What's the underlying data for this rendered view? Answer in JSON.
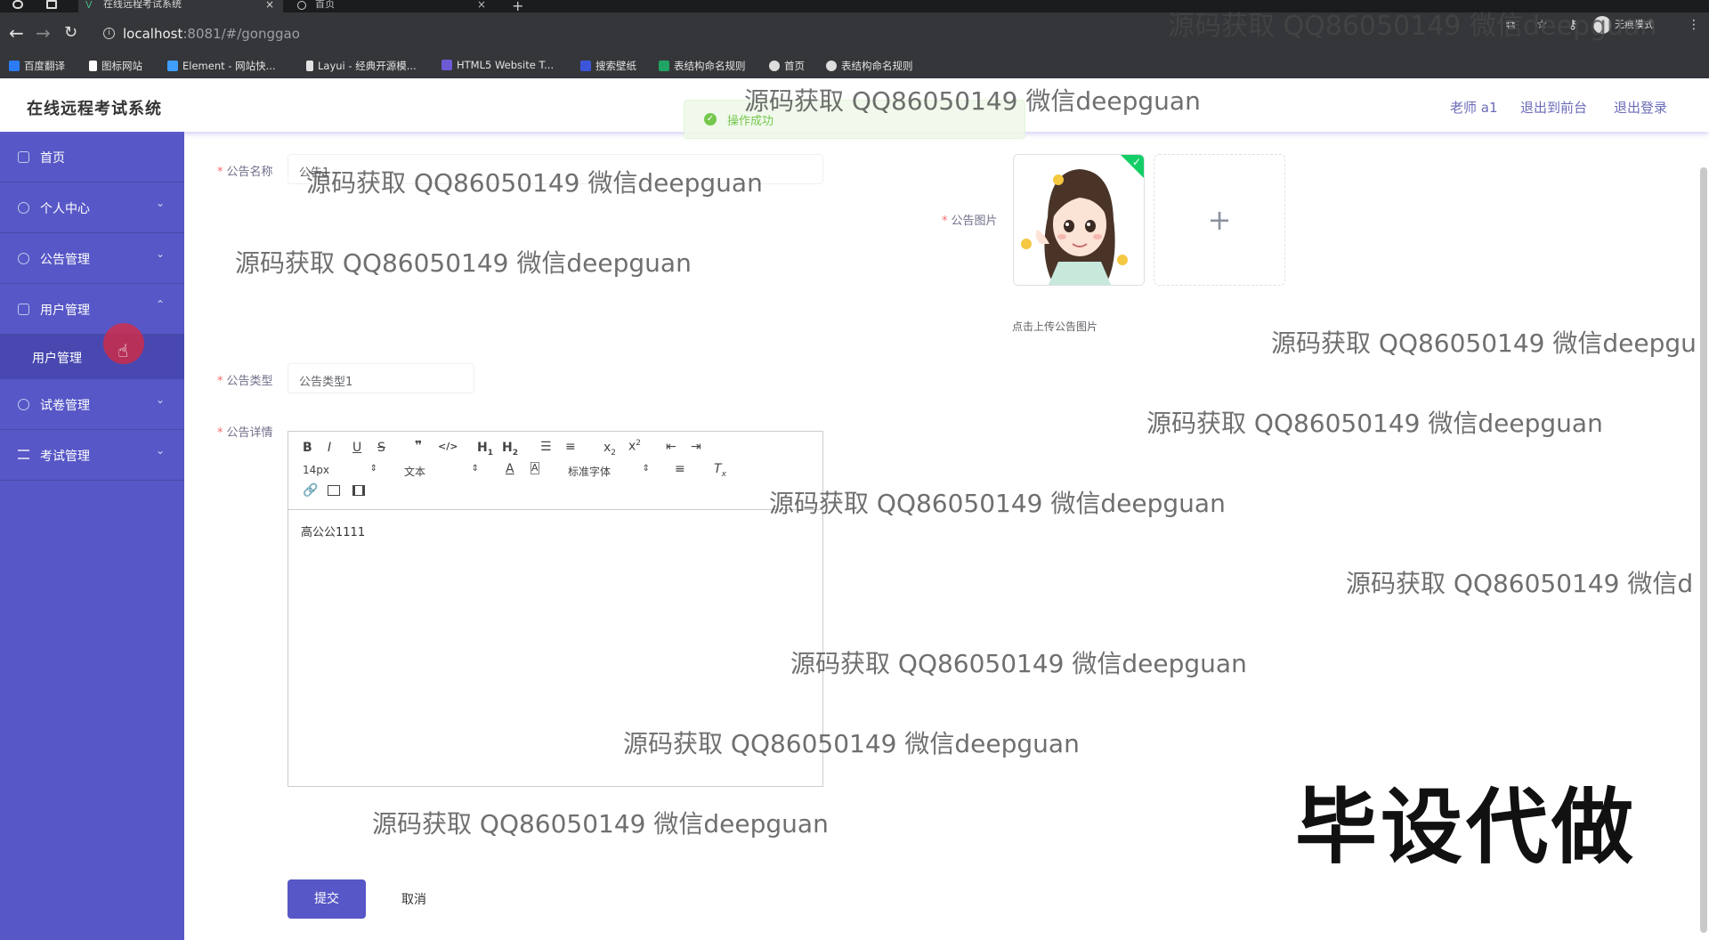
{
  "browser": {
    "tabs": [
      {
        "label": "在线远程考试系统",
        "close": "×"
      },
      {
        "label": "首页",
        "close": "×"
      }
    ],
    "new_tab": "+",
    "url_host": "localhost",
    "url_path": ":8081/#/gonggao",
    "incognito_label": "无痕模式",
    "bookmarks": [
      {
        "label": "百度翻译",
        "icon": "baidu-translate-icon",
        "color": "#2b7cf6"
      },
      {
        "label": "图标网站",
        "icon": "flag-icon",
        "color": "#ffffff"
      },
      {
        "label": "Element - 网站快...",
        "icon": "element-icon",
        "color": "#409eff"
      },
      {
        "label": "Layui - 经典开源模...",
        "icon": "layui-icon",
        "color": "#e2e2e2"
      },
      {
        "label": "HTML5 Website T...",
        "icon": "html5-icon",
        "color": "#6b5cd6"
      },
      {
        "label": "搜索壁纸",
        "icon": "wallpaper-icon",
        "color": "#3b55d9"
      },
      {
        "label": "表结构命名规则",
        "icon": "sheet-icon",
        "color": "#1fa463"
      },
      {
        "label": "首页",
        "icon": "globe-icon",
        "color": "#dddddd"
      },
      {
        "label": "表结构命名规则",
        "icon": "globe-icon",
        "color": "#dddddd"
      }
    ]
  },
  "header": {
    "title": "在线远程考试系统",
    "user": "老师 a1",
    "back_front": "退出到前台",
    "logout": "退出登录"
  },
  "sidebar": {
    "items": [
      {
        "label": "首页",
        "arrow": ""
      },
      {
        "label": "个人中心",
        "arrow": "⌄"
      },
      {
        "label": "公告管理",
        "arrow": "⌄"
      },
      {
        "label": "用户管理",
        "arrow": "⌃"
      },
      {
        "label": "试卷管理",
        "arrow": "⌄"
      },
      {
        "label": "考试管理",
        "arrow": "⌄"
      }
    ],
    "submenu": {
      "label": "用户管理"
    }
  },
  "toast": {
    "message": "操作成功"
  },
  "form": {
    "name_label": "公告名称",
    "name_value": "公告1",
    "image_label": "公告图片",
    "image_tip": "点击上传公告图片",
    "type_label": "公告类型",
    "type_value": "公告类型1",
    "detail_label": "公告详情",
    "editor": {
      "font_size": "14px",
      "heading": "文本",
      "font_family": "标准字体",
      "content": "高公公1111"
    },
    "submit": "提交",
    "cancel": "取消"
  },
  "watermarks": [
    "源码获取 QQ86050149 微信deepguan",
    "源码获取 QQ86050149 微信deepguan",
    "源码获取 QQ86050149 微信deepguan",
    "源码获取 QQ86050149 微信deepguan",
    "源码获取 QQ86050149 微信deepgu",
    "源码获取 QQ86050149 微信deepguan",
    "源码获取 QQ86050149 微信deepguan",
    "源码获取 QQ86050149 微信d",
    "源码获取 QQ86050149 微信deepguan",
    "源码获取 QQ86050149 微信deepguan",
    "源码获取 QQ86050149 微信deepguan"
  ],
  "promo": "毕设代做",
  "colors": {
    "primary": "#5757c7",
    "success": "#67c23a",
    "danger": "#f56c6c"
  }
}
